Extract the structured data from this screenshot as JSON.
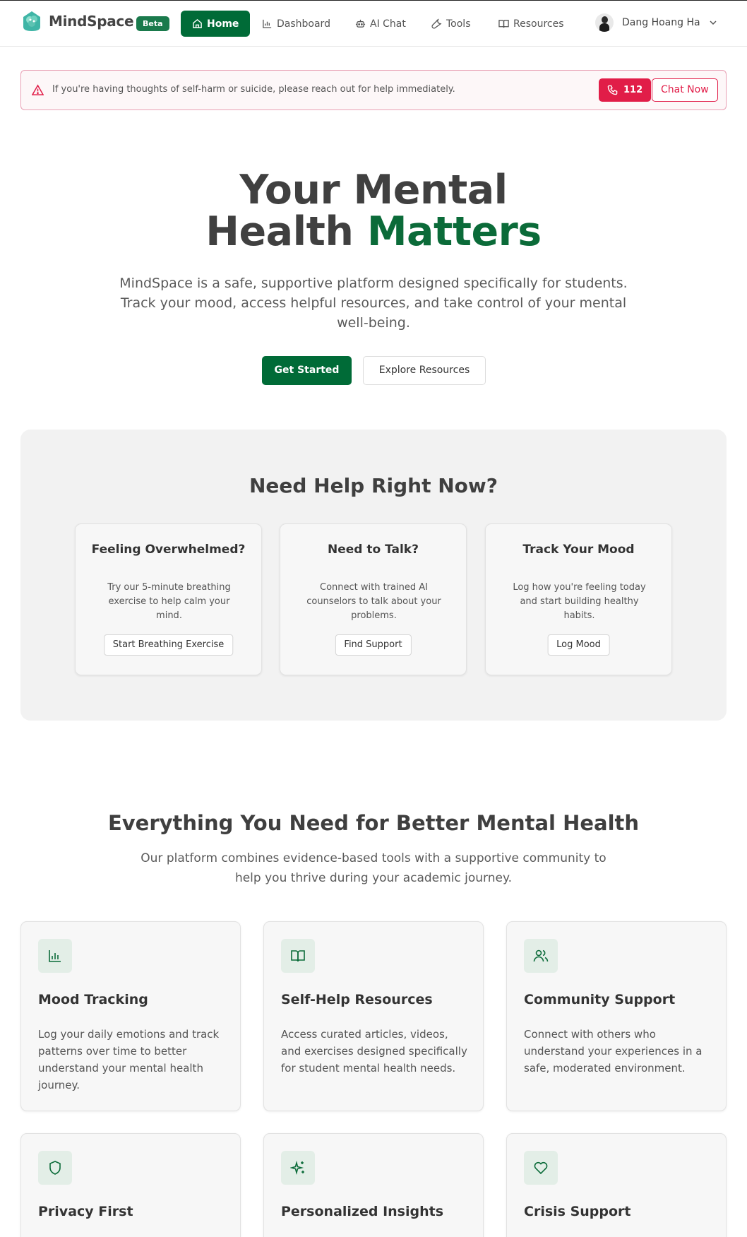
{
  "header": {
    "app_name": "MindSpace",
    "badge": "Beta",
    "nav": [
      {
        "label": "Home",
        "icon": "home-icon",
        "active": true
      },
      {
        "label": "Dashboard",
        "icon": "bar-chart-icon"
      },
      {
        "label": "AI Chat",
        "icon": "bot-icon"
      },
      {
        "label": "Tools",
        "icon": "wrench-icon"
      },
      {
        "label": "Resources",
        "icon": "book-icon"
      }
    ],
    "user_name": "Dang Hoang Ha"
  },
  "crisis_banner": {
    "message": "If you're having thoughts of self-harm or suicide, please reach out for help immediately.",
    "call_label": "112",
    "chat_label": "Chat Now"
  },
  "hero": {
    "title_line1": "Your Mental",
    "title_line2_plain": "Health ",
    "title_line2_accent": "Matters",
    "subtitle": "MindSpace is a safe, supportive platform designed specifically for students. Track your mood, access helpful resources, and take control of your mental well-being.",
    "primary_button": "Get Started",
    "secondary_button": "Explore Resources"
  },
  "help": {
    "title": "Need Help Right Now?",
    "cards": [
      {
        "title": "Feeling Overwhelmed?",
        "text": "Try our 5-minute breathing exercise to help calm your mind.",
        "button": "Start Breathing Exercise"
      },
      {
        "title": "Need to Talk?",
        "text": "Connect with trained AI counselors to talk about your problems.",
        "button": "Find Support"
      },
      {
        "title": "Track Your Mood",
        "text": "Log how you're feeling today and start building healthy habits.",
        "button": "Log Mood"
      }
    ]
  },
  "features": {
    "title": "Everything You Need for Better Mental Health",
    "subtitle": "Our platform combines evidence-based tools with a supportive community to help you thrive during your academic journey.",
    "cards": [
      {
        "title": "Mood Tracking",
        "text": "Log your daily emotions and track patterns over time to better understand your mental health journey.",
        "icon": "bar-chart-icon"
      },
      {
        "title": "Self-Help Resources",
        "text": "Access curated articles, videos, and exercises designed specifically for student mental health needs.",
        "icon": "book-icon"
      },
      {
        "title": "Community Support",
        "text": "Connect with others who understand your experiences in a safe, moderated environment.",
        "icon": "users-icon"
      },
      {
        "title": "Privacy First",
        "text": "",
        "icon": "shield-icon"
      },
      {
        "title": "Personalized Insights",
        "text": "",
        "icon": "sparkles-icon"
      },
      {
        "title": "Crisis Support",
        "text": "",
        "icon": "heart-icon"
      }
    ]
  },
  "colors": {
    "brand_green": "#006b37",
    "accent_green": "#0b6b39",
    "crisis_red": "#e11d48"
  }
}
